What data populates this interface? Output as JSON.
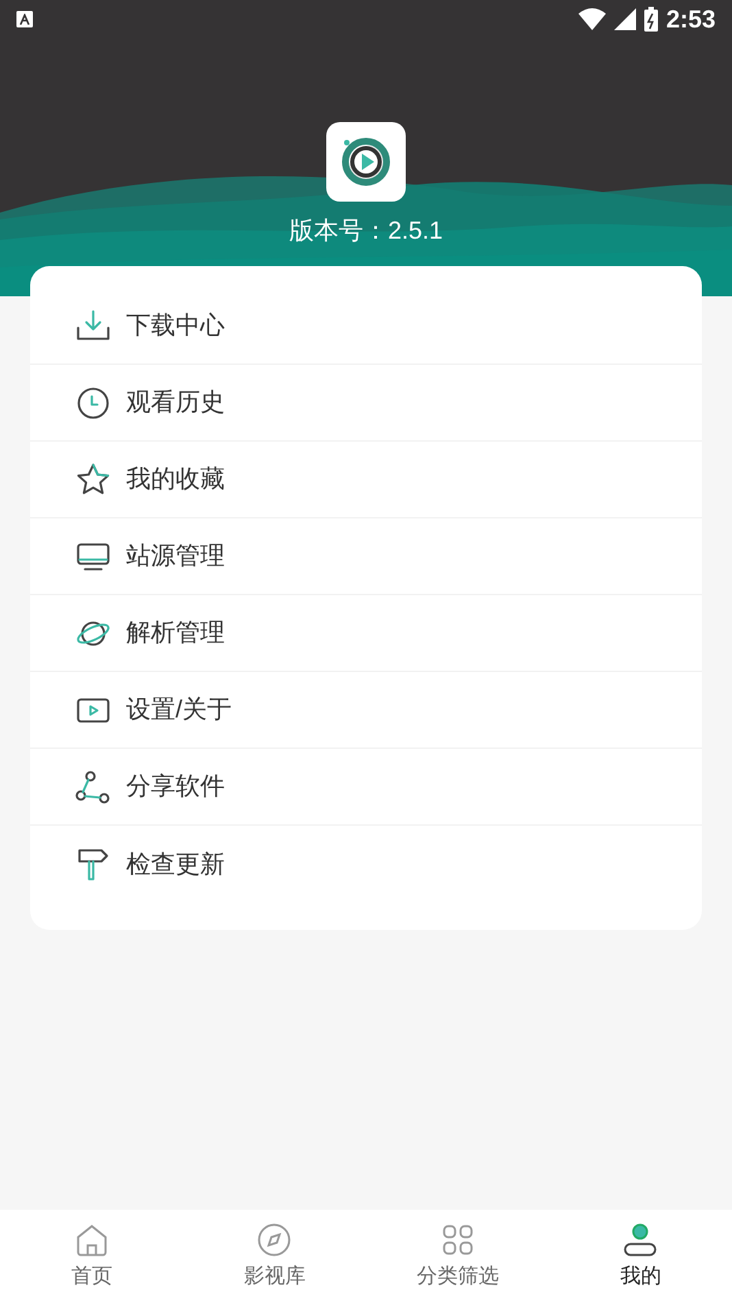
{
  "status_bar": {
    "time": "2:53"
  },
  "header": {
    "version": "版本号：2.5.1"
  },
  "menu": [
    {
      "kind": "download",
      "label": "下载中心"
    },
    {
      "kind": "history",
      "label": "观看历史"
    },
    {
      "kind": "favorite",
      "label": "我的收藏"
    },
    {
      "kind": "source",
      "label": "站源管理"
    },
    {
      "kind": "parse",
      "label": "解析管理"
    },
    {
      "kind": "settings",
      "label": "设置/关于"
    },
    {
      "kind": "share",
      "label": "分享软件"
    },
    {
      "kind": "update",
      "label": "检查更新"
    }
  ],
  "tabs": [
    {
      "kind": "home",
      "label": "首页",
      "selected": false
    },
    {
      "kind": "library",
      "label": "影视库",
      "selected": false
    },
    {
      "kind": "category",
      "label": "分类筛选",
      "selected": false
    },
    {
      "kind": "mine",
      "label": "我的",
      "selected": true
    }
  ]
}
